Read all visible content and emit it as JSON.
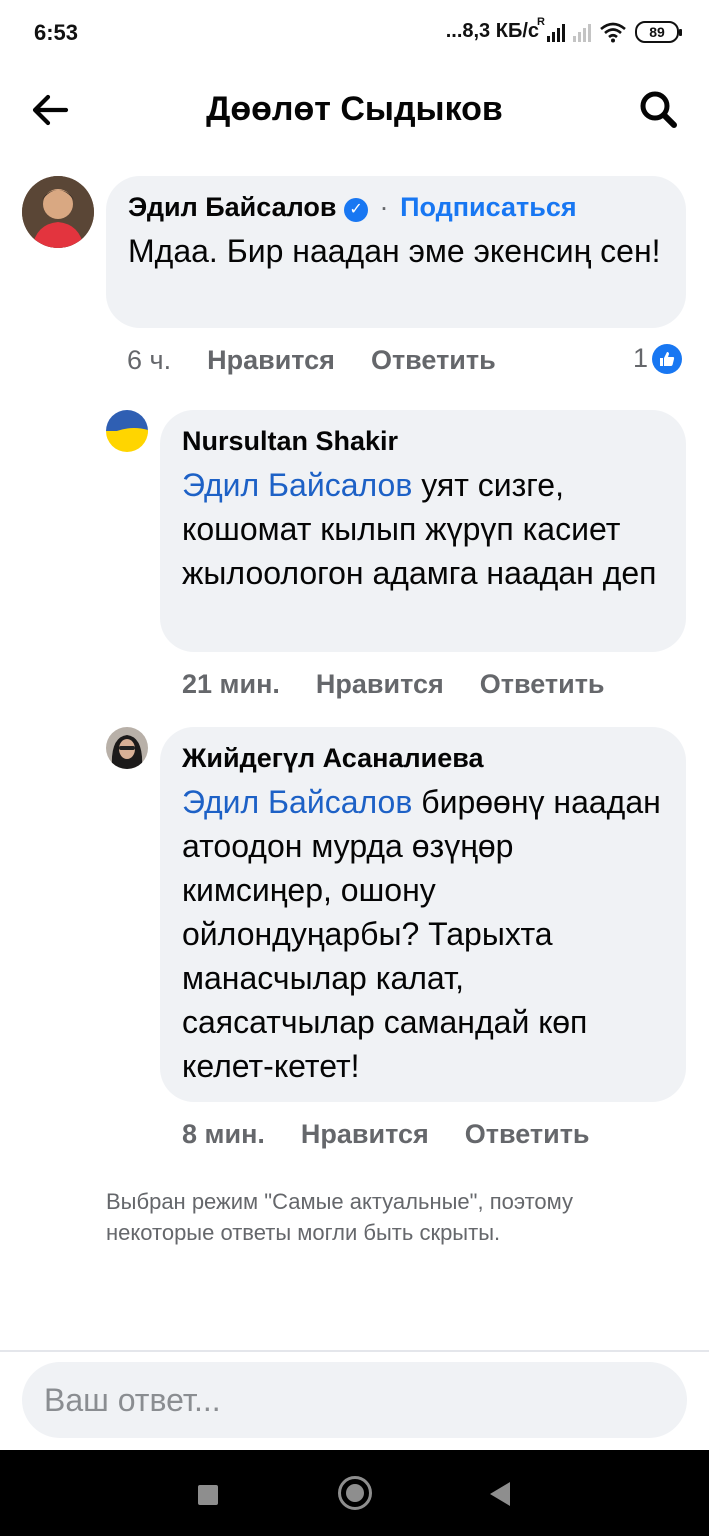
{
  "status_bar": {
    "time": "6:53",
    "network_speed": "...8,3 КБ/с",
    "roaming_indicator": "R",
    "battery_level": "89",
    "icons": [
      "signal-icon",
      "signal-weak-icon",
      "wifi-icon",
      "battery-icon"
    ]
  },
  "header": {
    "title": "Дөөлөт Сыдыков",
    "back_icon": "arrow-left-icon",
    "search_icon": "search-icon"
  },
  "comments": [
    {
      "author": "Эдил Байсалов",
      "verified": true,
      "separator": "·",
      "follow_label": "Подписаться",
      "mention": "",
      "text": "Мдаа. Бир наадан эме экенсиң сен!",
      "time": "6 ч.",
      "like_label": "Нравится",
      "reply_label": "Ответить",
      "like_count": "1"
    },
    {
      "author": "Nursultan Shakir",
      "mention": "Эдил Байсалов",
      "text": " уят сизге, кошомат кылып жүрүп касиет жылоологон адамга наадан деп",
      "time": "21 мин.",
      "like_label": "Нравится",
      "reply_label": "Ответить"
    },
    {
      "author": "Жийдегүл Асаналиева",
      "mention": "Эдил Байсалов",
      "text": " бирөөнү наадан атоодон мурда өзүңөр кимсиңер, ошону ойлондуңарбы? Тарыхта манасчылар калат, саясатчылар самандай көп келет-кетет!",
      "time": "8 мин.",
      "like_label": "Нравится",
      "reply_label": "Ответить"
    }
  ],
  "notice": "Выбран режим \"Самые актуальные\", поэтому некоторые ответы могли быть скрыты.",
  "reply_input": {
    "placeholder": "Ваш ответ..."
  },
  "colors": {
    "accent": "#1877f2",
    "mention": "#1d61c6",
    "bubble": "#f0f2f5",
    "meta_text": "#65676b"
  }
}
